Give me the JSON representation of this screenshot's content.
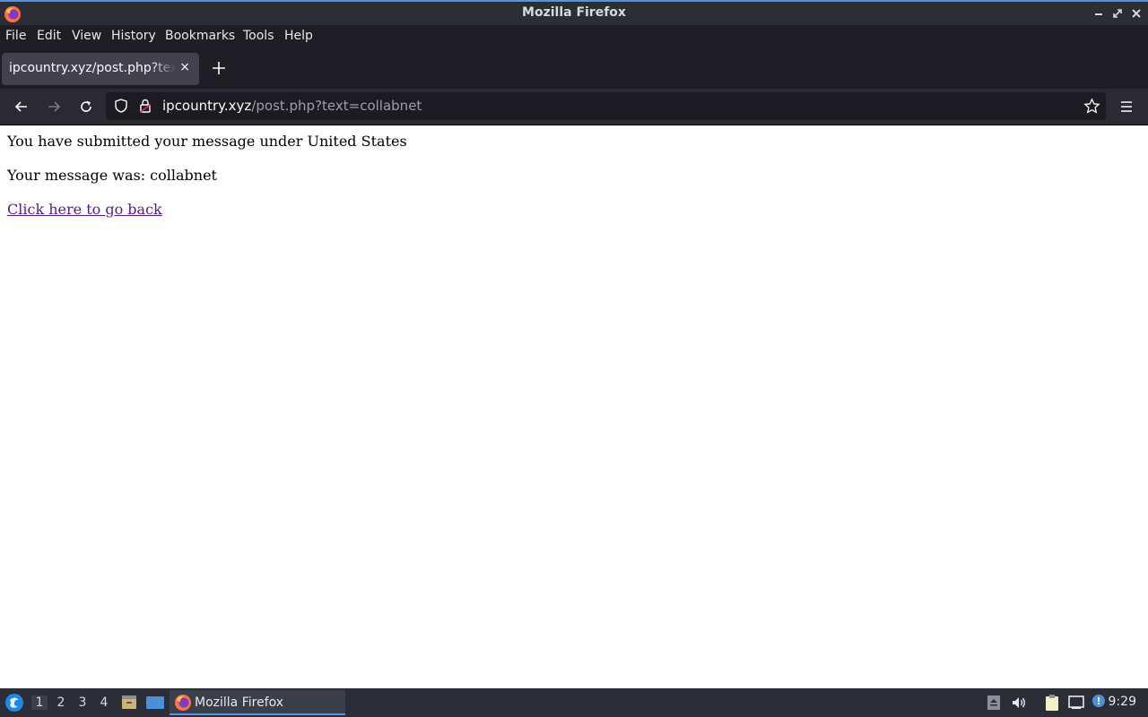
{
  "window": {
    "title": "Mozilla Firefox"
  },
  "menubar": {
    "file": "File",
    "edit": "Edit",
    "view": "View",
    "history": "History",
    "bookmarks": "Bookmarks",
    "tools": "Tools",
    "help": "Help"
  },
  "tab": {
    "title": "ipcountry.xyz/post.php?text=collabnet",
    "close": "×"
  },
  "url": {
    "host": "ipcountry.xyz",
    "path": "/post.php?text=collabnet"
  },
  "page": {
    "line1": "You have submitted your message under United States",
    "line2": "Your message was: collabnet",
    "back_link": "Click here to go back"
  },
  "taskbar": {
    "workspaces": [
      "1",
      "2",
      "3",
      "4"
    ],
    "active_workspace": "1",
    "task_label": "Mozilla Firefox",
    "clock": "9:29"
  },
  "colors": {
    "accent": "#5294e2",
    "link_visited": "#551a8b",
    "toolbar": "#2b2a33",
    "urlbar": "#1c1b22",
    "tab_selected": "#42414d"
  }
}
